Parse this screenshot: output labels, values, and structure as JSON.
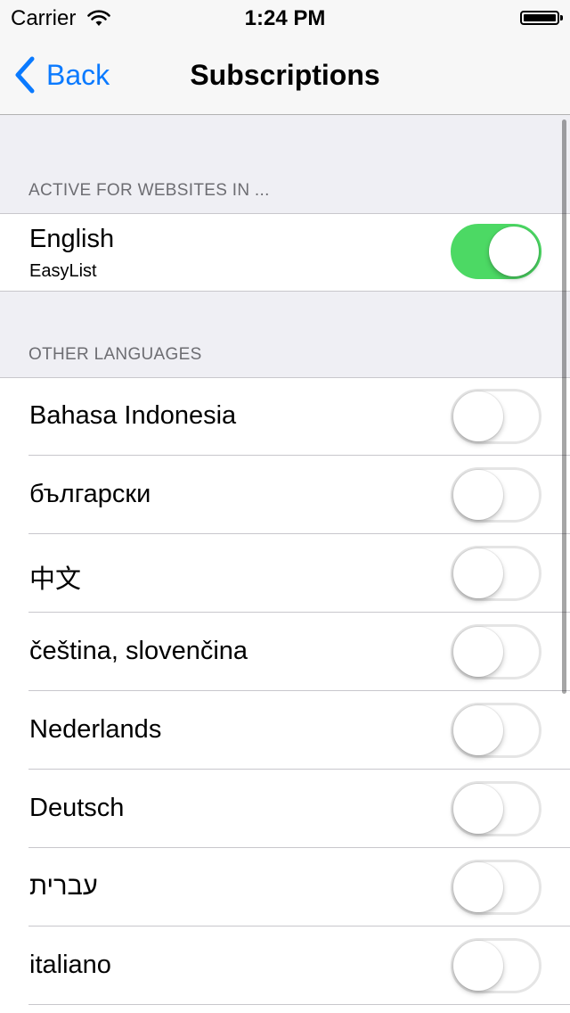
{
  "status_bar": {
    "carrier": "Carrier",
    "time": "1:24 PM"
  },
  "nav": {
    "back_label": "Back",
    "title": "Subscriptions",
    "accent": "#0a7aff"
  },
  "sections": {
    "active_header": "ACTIVE FOR WEBSITES IN ...",
    "other_header": "OTHER LANGUAGES"
  },
  "active": {
    "label": "English",
    "sublabel": "EasyList",
    "enabled": true
  },
  "languages": [
    {
      "label": "Bahasa Indonesia",
      "enabled": false
    },
    {
      "label": "български",
      "enabled": false
    },
    {
      "label": "中文",
      "enabled": false
    },
    {
      "label": "čeština, slovenčina",
      "enabled": false
    },
    {
      "label": "Nederlands",
      "enabled": false
    },
    {
      "label": "Deutsch",
      "enabled": false
    },
    {
      "label": "עברית",
      "enabled": false
    },
    {
      "label": "italiano",
      "enabled": false
    }
  ],
  "colors": {
    "toggle_on": "#4cd964",
    "background": "#efeff4"
  }
}
